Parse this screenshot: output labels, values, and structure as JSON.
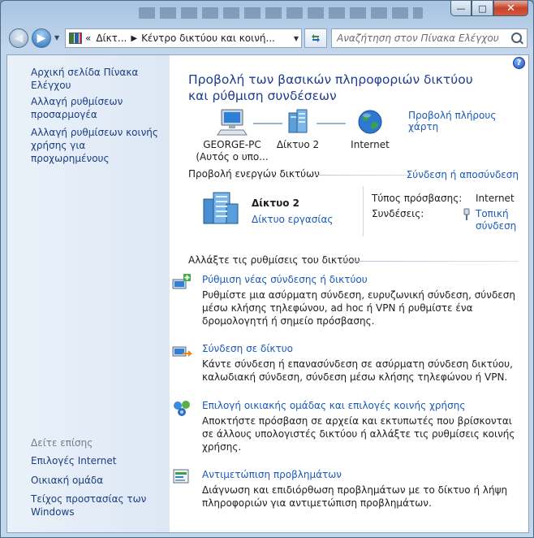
{
  "titlebar": {
    "minimize": "—",
    "maximize": "□",
    "close": "✕"
  },
  "nav": {
    "back": "◀",
    "forward": "▶"
  },
  "address": {
    "prefix": "«",
    "crumbs": [
      "Δίκτ...",
      "Κέντρο δικτύου και κοινή..."
    ]
  },
  "search": {
    "placeholder": "Αναζήτηση στον Πίνακα Ελέγχου"
  },
  "sidebar": {
    "home": "Αρχική σελίδα Πίνακα Ελέγχου",
    "adapter": "Αλλαγή ρυθμίσεων προσαρμογέα",
    "sharing": "Αλλαγή ρυθμίσεων κοινής χρήσης για προχωρημένους",
    "see_also": "Δείτε επίσης",
    "internet_options": "Επιλογές Internet",
    "homegroup": "Οικιακή ομάδα",
    "firewall": "Τείχος προστασίας των Windows"
  },
  "main": {
    "help": "?",
    "title": "Προβολή των βασικών πληροφοριών δικτύου και ρύθμιση συνδέσεων",
    "full_map": "Προβολή πλήρους χάρτη",
    "map": {
      "computer": "GEORGE-PC",
      "computer_sub": "(Αυτός ο υπο...",
      "network": "Δίκτυο 2",
      "internet": "Internet"
    },
    "active_networks": "Προβολή ενεργών δικτύων",
    "connect_disconnect": "Σύνδεση ή αποσύνδεση",
    "network_name": "Δίκτυο 2",
    "network_type": "Δίκτυο εργασίας",
    "access_label": "Τύπος πρόσβασης:",
    "access_value": "Internet",
    "connections_label": "Συνδέσεις:",
    "connections_value": "Τοπική σύνδεση",
    "change_settings": "Αλλάξτε τις ρυθμίσεις του δικτύου",
    "tasks": [
      {
        "title": "Ρύθμιση νέας σύνδεσης ή δικτύου",
        "desc": "Ρυθμίστε μια ασύρματη σύνδεση, ευρυζωνική σύνδεση, σύνδεση μέσω κλήσης τηλεφώνου, ad hoc ή VPN ή ρυθμίστε ένα δρομολογητή ή σημείο πρόσβασης."
      },
      {
        "title": "Σύνδεση σε δίκτυο",
        "desc": "Κάντε σύνδεση ή επανασύνδεση σε ασύρματη σύνδεση δικτύου, καλωδιακή σύνδεση, σύνδεση μέσω κλήσης τηλεφώνου ή VPN."
      },
      {
        "title": "Επιλογή οικιακής ομάδας και επιλογές κοινής χρήσης",
        "desc": "Αποκτήστε πρόσβαση σε αρχεία και εκτυπωτές που βρίσκονται σε άλλους υπολογιστές δικτύου ή αλλάξτε τις ρυθμίσεις κοινής χρήσης."
      },
      {
        "title": "Αντιμετώπιση προβλημάτων",
        "desc": "Διάγνωση και επιδιόρθωση προβλημάτων με το δίκτυο ή λήψη πληροφοριών για αντιμετώπιση προβλημάτων."
      }
    ]
  }
}
